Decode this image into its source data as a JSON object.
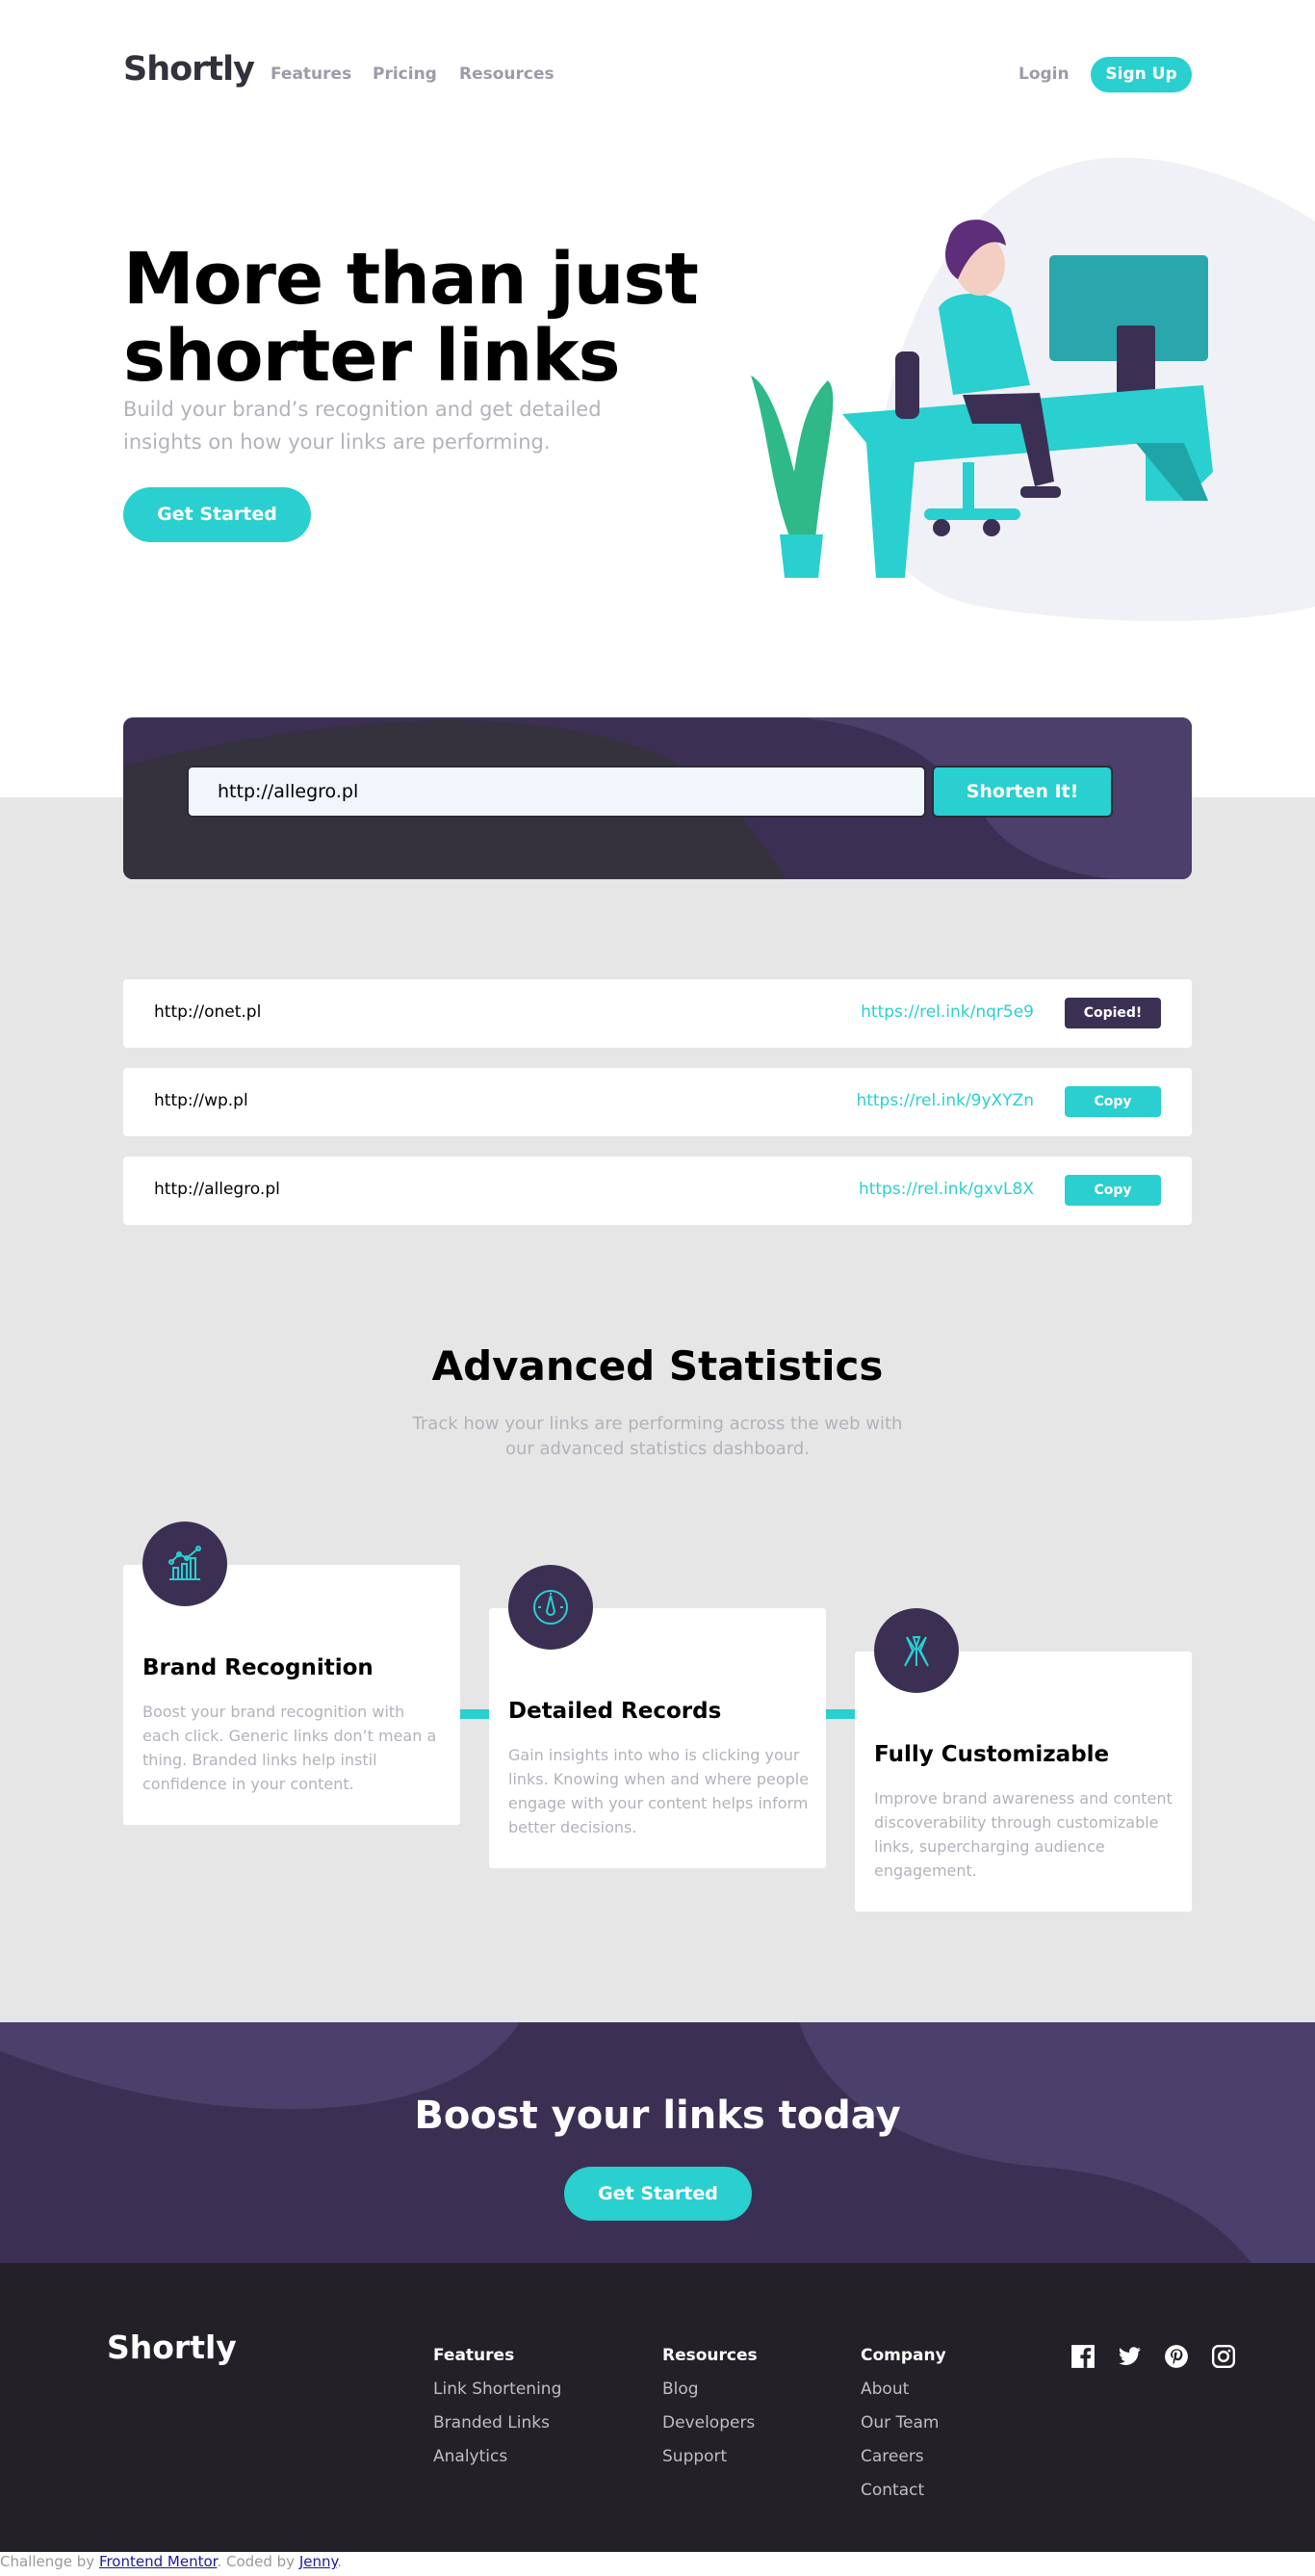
{
  "nav": {
    "logo": "Shortly",
    "links": [
      "Features",
      "Pricing",
      "Resources"
    ],
    "login": "Login",
    "signup": "Sign Up"
  },
  "hero": {
    "title_line1": "More than just",
    "title_line2": "shorter links",
    "subtitle": "Build your brand’s recognition and get detailed insights on how your links are performing.",
    "cta": "Get Started"
  },
  "shorten": {
    "input_value": "http://allegro.pl",
    "button": "Shorten It!"
  },
  "results": [
    {
      "original": "http://onet.pl",
      "short": "https://rel.ink/nqr5e9",
      "button": "Copied!"
    },
    {
      "original": "http://wp.pl",
      "short": "https://rel.ink/9yXYZn",
      "button": "Copy"
    },
    {
      "original": "http://allegro.pl",
      "short": "https://rel.ink/gxvL8X",
      "button": "Copy"
    }
  ],
  "stats": {
    "title": "Advanced Statistics",
    "subtitle": "Track how your links are performing across the web with our advanced statistics dashboard.",
    "cards": [
      {
        "icon": "brand-recognition-icon",
        "title": "Brand Recognition",
        "text": "Boost your brand recognition with each click. Generic links don’t mean a thing. Branded links help instil confidence in your content."
      },
      {
        "icon": "detailed-records-icon",
        "title": "Detailed Records",
        "text": "Gain insights into who is clicking your links. Knowing when and where people engage with your content helps inform better decisions."
      },
      {
        "icon": "fully-customizable-icon",
        "title": "Fully Customizable",
        "text": "Improve brand awareness and content discoverability through customizable links, supercharging audience engagement."
      }
    ]
  },
  "boost": {
    "title": "Boost your links today",
    "cta": "Get Started"
  },
  "footer": {
    "logo": "Shortly",
    "columns": [
      {
        "heading": "Features",
        "links": [
          "Link Shortening",
          "Branded Links",
          "Analytics"
        ]
      },
      {
        "heading": "Resources",
        "links": [
          "Blog",
          "Developers",
          "Support"
        ]
      },
      {
        "heading": "Company",
        "links": [
          "About",
          "Our Team",
          "Careers",
          "Contact"
        ]
      }
    ],
    "social": [
      "facebook-icon",
      "twitter-icon",
      "pinterest-icon",
      "instagram-icon"
    ]
  },
  "credit": {
    "prefix": "Challenge by ",
    "fm": "Frontend Mentor",
    "middle": ". Coded by ",
    "author": "Jenny",
    "suffix": "."
  },
  "colors": {
    "cyan": "#2acfcf",
    "dark_violet": "#3b3054",
    "very_dark": "#232027",
    "gray_bg": "#e6e6e6",
    "gray_text": "#b4b1bb"
  }
}
